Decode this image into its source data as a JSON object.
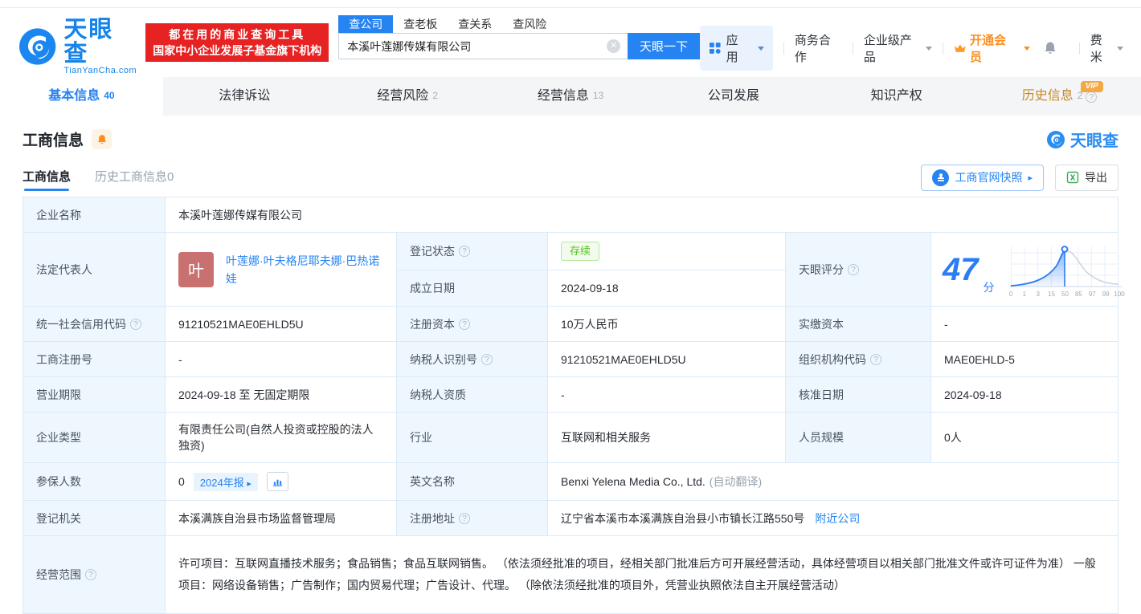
{
  "header": {
    "brand": "天眼查",
    "brand_domain": "TianYanCha.com",
    "slogan_line1": "都在用的商业查询工具",
    "slogan_line2": "国家中小企业发展子基金旗下机构",
    "search_tabs": [
      {
        "label": "查公司",
        "active": true
      },
      {
        "label": "查老板",
        "active": false
      },
      {
        "label": "查关系",
        "active": false
      },
      {
        "label": "查风险",
        "active": false
      }
    ],
    "search_value": "本溪叶莲娜传媒有限公司",
    "search_button": "天眼一下",
    "menu_apps": "应用",
    "menu_coop": "商务合作",
    "menu_enterprise": "企业级产品",
    "menu_vip": "开通会员",
    "menu_user": "费米"
  },
  "vip_badge": "VIP",
  "nav_tabs": [
    {
      "label": "基本信息",
      "count": "40",
      "active": true,
      "vip": false
    },
    {
      "label": "法律诉讼",
      "count": "",
      "active": false,
      "vip": false
    },
    {
      "label": "经营风险",
      "count": "2",
      "active": false,
      "vip": false
    },
    {
      "label": "经营信息",
      "count": "13",
      "active": false,
      "vip": false
    },
    {
      "label": "公司发展",
      "count": "",
      "active": false,
      "vip": false
    },
    {
      "label": "知识产权",
      "count": "",
      "active": false,
      "vip": false
    },
    {
      "label": "历史信息",
      "count": "2",
      "active": false,
      "vip": true
    }
  ],
  "section": {
    "title": "工商信息",
    "watermark_brand": "天眼查"
  },
  "subtabs": {
    "active": "工商信息",
    "inactive": "历史工商信息0"
  },
  "actions": {
    "snapshot": "工商官网快照",
    "export": "导出"
  },
  "info": {
    "company_name_label": "企业名称",
    "company_name": "本溪叶莲娜传媒有限公司",
    "legal_label": "法定代表人",
    "avatar_char": "叶",
    "legal_name": "叶莲娜·叶夫格尼耶夫娜·巴热诺娃",
    "status_label": "登记状态",
    "status": "存续",
    "established_label": "成立日期",
    "established": "2024-09-18",
    "score_label": "天眼评分",
    "score": "47",
    "score_unit": "分"
  },
  "score_chart": {
    "type": "area",
    "score": 47,
    "ticks": [
      "0",
      "1",
      "3",
      "15",
      "50",
      "85",
      "97",
      "99",
      "100"
    ]
  },
  "grid_rows": [
    [
      {
        "label": "统一社会信用代码",
        "help": true,
        "value": "91210521MAE0EHLD5U"
      },
      {
        "label": "注册资本",
        "help": true,
        "value": "10万人民币"
      },
      {
        "label": "实缴资本",
        "help": false,
        "value": "-"
      }
    ],
    [
      {
        "label": "工商注册号",
        "help": false,
        "value": "-"
      },
      {
        "label": "纳税人识别号",
        "help": true,
        "value": "91210521MAE0EHLD5U"
      },
      {
        "label": "组织机构代码",
        "help": true,
        "value": "MAE0EHLD-5"
      }
    ],
    [
      {
        "label": "营业期限",
        "help": false,
        "value": "2024-09-18 至 无固定期限"
      },
      {
        "label": "纳税人资质",
        "help": false,
        "value": "-"
      },
      {
        "label": "核准日期",
        "help": false,
        "value": "2024-09-18"
      }
    ],
    [
      {
        "label": "企业类型",
        "help": false,
        "value": "有限责任公司(自然人投资或控股的法人独资)"
      },
      {
        "label": "行业",
        "help": false,
        "value": "互联网和相关服务"
      },
      {
        "label": "人员规模",
        "help": false,
        "value": "0人"
      }
    ]
  ],
  "insured": {
    "label": "参保人数",
    "value": "0",
    "report_badge": "2024年报"
  },
  "english": {
    "label": "英文名称",
    "value": "Benxi Yelena Media Co., Ltd.",
    "note": "(自动翻译)"
  },
  "registry": {
    "label": "登记机关",
    "value": "本溪满族自治县市场监督管理局"
  },
  "address": {
    "label": "注册地址",
    "value": "辽宁省本溪市本溪满族自治县小市镇长江路550号",
    "link": "附近公司"
  },
  "scope": {
    "label": "经营范围",
    "value": "许可项目：互联网直播技术服务；食品销售；食品互联网销售。 （依法须经批准的项目，经相关部门批准后方可开展经营活动，具体经营项目以相关部门批准文件或许可证件为准） 一般项目：网络设备销售；广告制作；国内贸易代理；广告设计、代理。 （除依法须经批准的项目外，凭营业执照依法自主开展经营活动）"
  }
}
